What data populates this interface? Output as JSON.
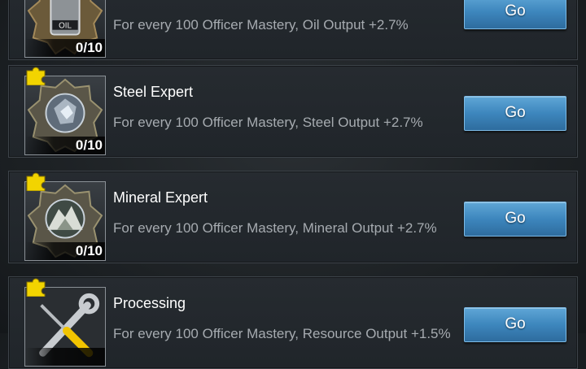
{
  "cards": [
    {
      "title": "",
      "description": "For every 100 Officer Mastery, Oil Output +2.7%",
      "count": "0/10",
      "button": "Go",
      "icon": "oil-barrel-icon"
    },
    {
      "title": "Steel Expert",
      "description": "For every 100 Officer Mastery, Steel Output +2.7%",
      "count": "0/10",
      "button": "Go",
      "icon": "steel-ore-icon"
    },
    {
      "title": "Mineral Expert",
      "description": "For every 100 Officer Mastery, Mineral Output +2.7%",
      "count": "0/10",
      "button": "Go",
      "icon": "mineral-mountain-icon"
    },
    {
      "title": "Processing",
      "description": "For every 100 Officer Mastery, Resource Output +1.5%",
      "count": "",
      "button": "Go",
      "icon": "wrench-screwdriver-icon"
    }
  ],
  "colors": {
    "button": "#3d86bd",
    "puzzle": "#f2d400"
  }
}
